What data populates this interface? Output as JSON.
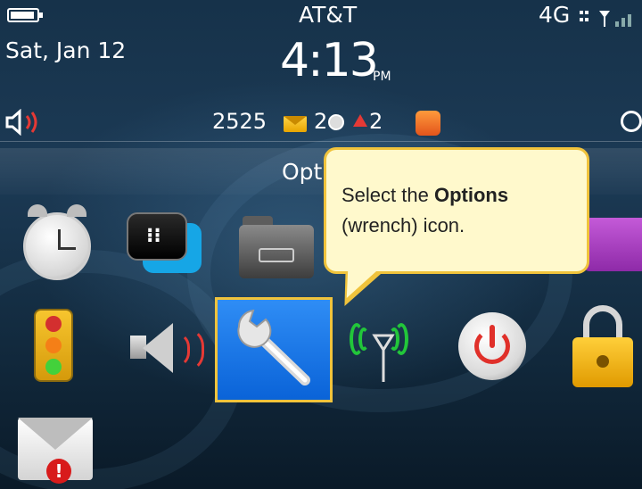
{
  "status_bar": {
    "date": "Sat, Jan 12",
    "carrier": "AT&T",
    "time": "4:13",
    "ampm": "PM",
    "network": "4G"
  },
  "notifications": {
    "message_count": "2525",
    "bbm_count": "2",
    "alert_count": "2"
  },
  "folder_title": "Opt",
  "callout": {
    "text_before": "Select the ",
    "text_bold": "Options",
    "text_after": "(wrench) icon."
  },
  "icons": [
    "alarm-clock-icon",
    "blackberry-messenger-icon",
    "folder-icon",
    "games-icon",
    "traffic-light-icon",
    "sound-icon",
    "options-wrench-icon",
    "manage-connections-icon",
    "power-icon",
    "lock-icon",
    "messages-alert-icon"
  ],
  "colors": {
    "selection_border": "#f0c33c",
    "options_bg": "#1a75e8",
    "callout_bg": "#fff9cc",
    "callout_border": "#f0c33c"
  }
}
